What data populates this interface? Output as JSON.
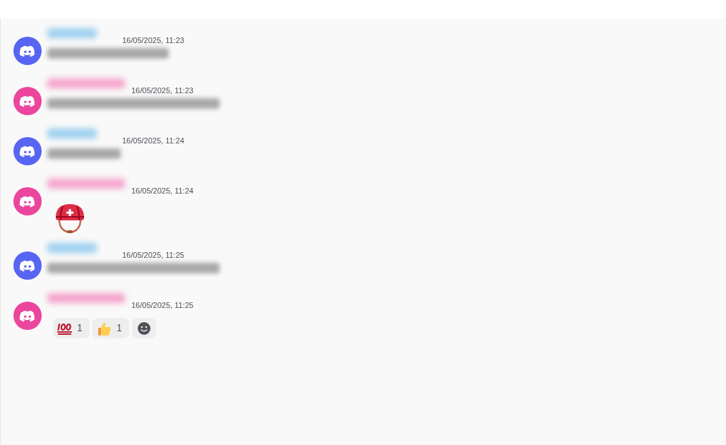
{
  "messages": [
    {
      "color": "#5865f2",
      "timestamp": "16/05/2025, 11:23",
      "kind": "text"
    },
    {
      "color": "#eb459e",
      "timestamp": "16/05/2025, 11:23",
      "kind": "text"
    },
    {
      "color": "#5865f2",
      "timestamp": "16/05/2025, 11:24",
      "kind": "text"
    },
    {
      "color": "#eb459e",
      "timestamp": "16/05/2025, 11:24",
      "kind": "sticker"
    },
    {
      "color": "#5865f2",
      "timestamp": "16/05/2025, 11:25",
      "kind": "text"
    },
    {
      "color": "#eb459e",
      "timestamp": "16/05/2025, 11:25",
      "kind": "reactions",
      "reactions": [
        {
          "kind": "hundred",
          "count": "1"
        },
        {
          "kind": "thumbs_up",
          "count": "1"
        },
        {
          "kind": "add"
        }
      ]
    }
  ]
}
